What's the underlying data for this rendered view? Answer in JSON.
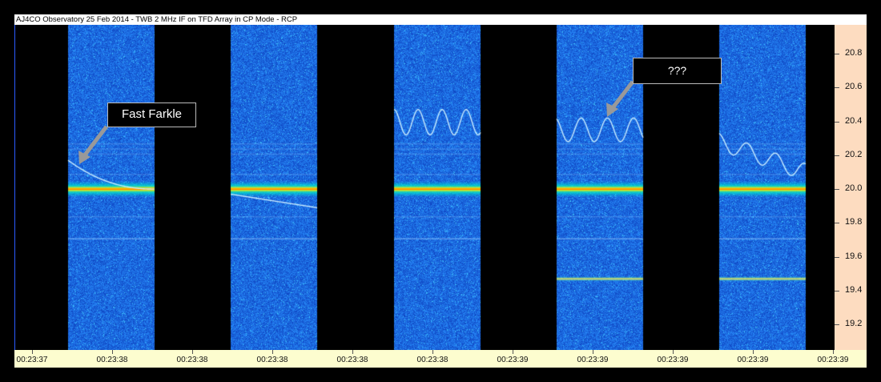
{
  "window": {
    "title": "AJ4CO Observatory 25 Feb 2014 - TWB 2 MHz IF on TFD Array in CP Mode - RCP"
  },
  "annotations": {
    "left": "Fast Farkle",
    "right": "???"
  },
  "colors": {
    "background": "#000000",
    "noise_base": "#1f5bd4",
    "carrier": "#ffd800",
    "trace": "#bfe8ff",
    "y_axis_bg": "#fddcc0",
    "x_axis_bg": "#fdfdcf"
  },
  "chart_data": {
    "type": "heatmap",
    "title": "AJ4CO Observatory 25 Feb 2014 - TWB 2 MHz IF on TFD Array in CP Mode - RCP",
    "xlabel": "",
    "ylabel": "",
    "y_ticks": [
      "20.8",
      "20.6",
      "20.4",
      "20.2",
      "20.0",
      "19.8",
      "19.6",
      "19.4",
      "19.2"
    ],
    "ylim": [
      19.05,
      20.97
    ],
    "x_ticks": [
      "00:23:37",
      "00:23:38",
      "00:23:38",
      "00:23:38",
      "00:23:38",
      "00:23:38",
      "00:23:39",
      "00:23:39",
      "00:23:39",
      "00:23:39",
      "00:23:39"
    ],
    "grid": false,
    "data_blocks": [
      {
        "index": 1,
        "signals": [
          "steady carrier at 20.0",
          "descending chirp from ~20.17 to 20.0"
        ]
      },
      {
        "index": 2,
        "signals": [
          "steady carrier at 20.0",
          "slow drift from 19.97 to 19.89"
        ]
      },
      {
        "index": 3,
        "signals": [
          "steady carrier at 20.0",
          "sinusoidal trace between ~20.32 and ~20.47"
        ]
      },
      {
        "index": 4,
        "signals": [
          "steady carrier at 20.0",
          "sinusoidal trace between ~20.28 and ~20.42",
          "steady line at 19.47"
        ]
      },
      {
        "index": 5,
        "signals": [
          "steady carrier at 20.0",
          "oscillating descending trace from ~20.3 to ~20.08",
          "steady line at 19.47"
        ]
      }
    ]
  }
}
